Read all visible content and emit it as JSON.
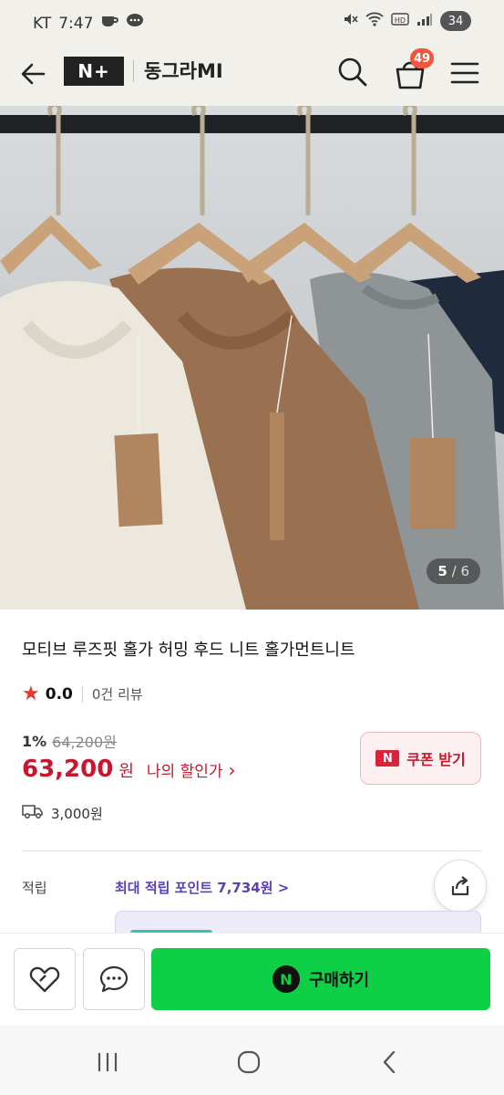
{
  "status_bar": {
    "carrier": "KT",
    "time": "7:47",
    "battery": "34"
  },
  "header": {
    "brand_badge": "N+",
    "store_name": "동그라MI",
    "cart_count": "49"
  },
  "hero": {
    "page_current": "5",
    "page_total": "/ 6"
  },
  "product": {
    "title": "모티브 루즈핏 홀가 허밍 후드 니트 홀가먼트니트",
    "rating": "0.0",
    "review_count": "0건 리뷰",
    "discount_rate": "1%",
    "original_price": "64,200원",
    "price": "63,200",
    "price_unit": "원",
    "my_discount_label": "나의 할인가",
    "coupon_label": "쿠폰 받기",
    "coupon_badge": "N",
    "shipping_fee": "3,000원"
  },
  "points": {
    "label": "적립",
    "max_points_link": "최대 적립 포인트 7,734원 >"
  },
  "bottom_bar": {
    "buy_badge": "N",
    "buy_label": "구매하기"
  },
  "colors": {
    "price_red": "#c7172f",
    "buy_green": "#0ed046",
    "points_purple": "#5b3fb8",
    "header_bg": "#f2f0ea"
  }
}
